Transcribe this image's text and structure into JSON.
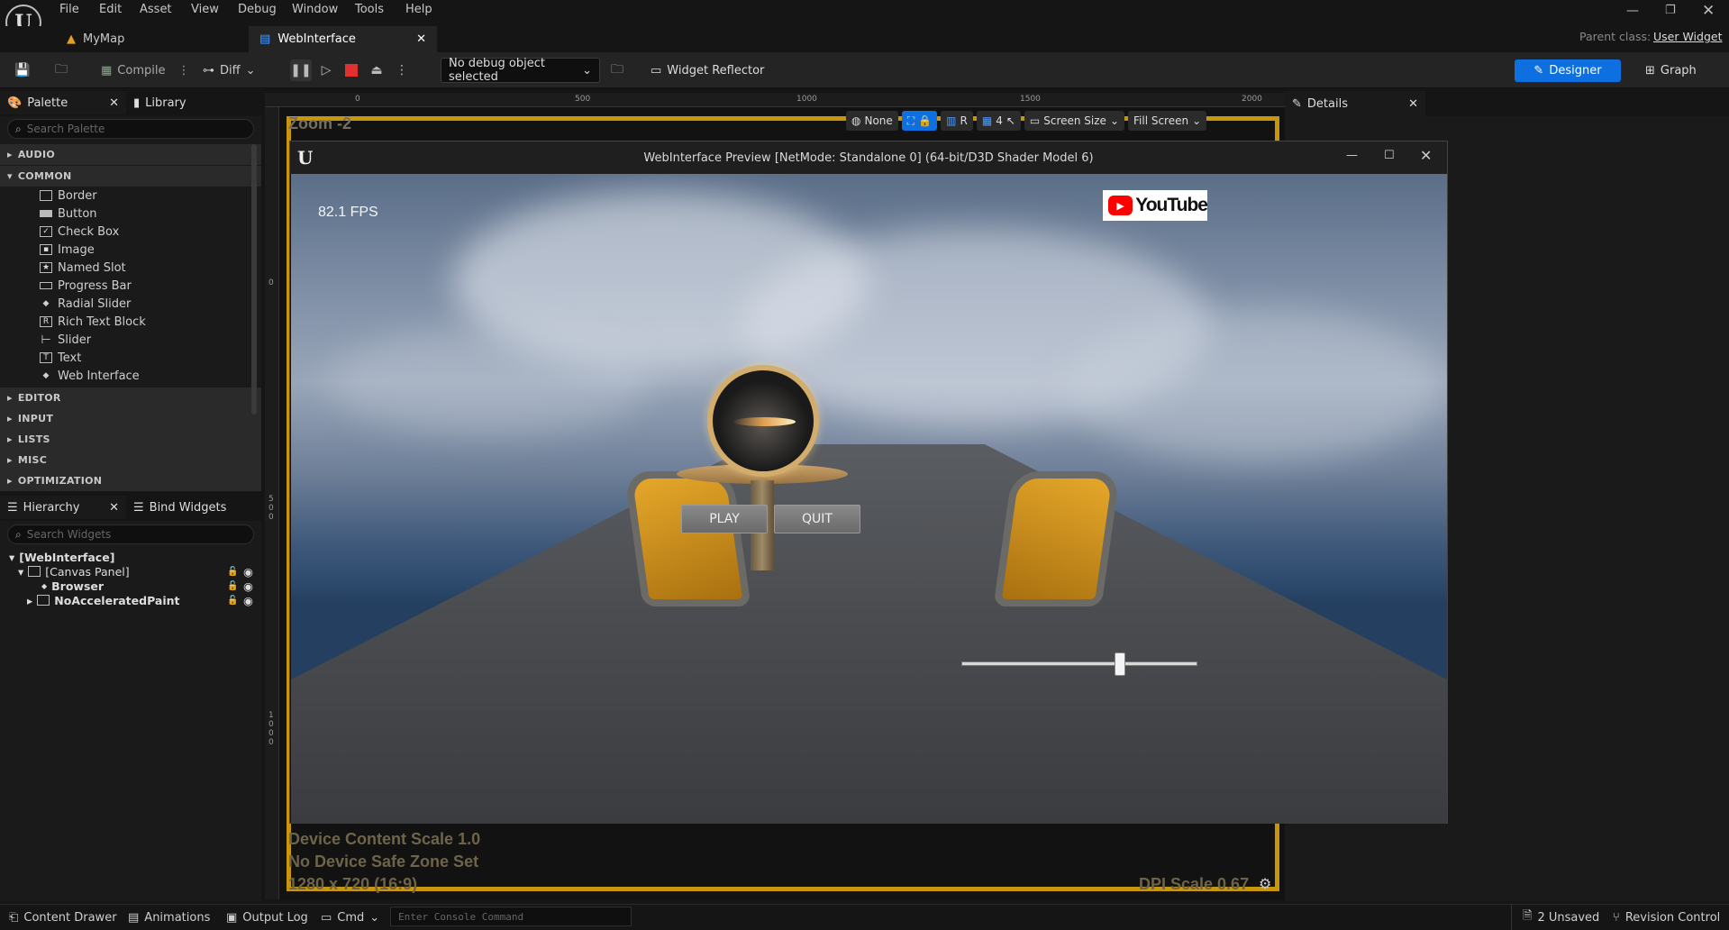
{
  "menu": [
    "File",
    "Edit",
    "Asset",
    "View",
    "Debug",
    "Window",
    "Tools",
    "Help"
  ],
  "tabs": [
    {
      "label": "MyMap"
    },
    {
      "label": "WebInterface"
    }
  ],
  "parent_class": {
    "label": "Parent class:",
    "value": "User Widget"
  },
  "toolbar": {
    "compile": "Compile",
    "diff": "Diff",
    "debug_select": "No debug object selected",
    "widget_reflector": "Widget Reflector",
    "designer": "Designer",
    "graph": "Graph"
  },
  "palette": {
    "tab": "Palette",
    "library_tab": "Library",
    "search_placeholder": "Search Palette",
    "categories": {
      "audio": "AUDIO",
      "common": "COMMON",
      "editor": "EDITOR",
      "input": "INPUT",
      "lists": "LISTS",
      "misc": "MISC",
      "optimization": "OPTIMIZATION"
    },
    "common_items": [
      "Border",
      "Button",
      "Check Box",
      "Image",
      "Named Slot",
      "Progress Bar",
      "Radial Slider",
      "Rich Text Block",
      "Slider",
      "Text",
      "Web Interface"
    ]
  },
  "hierarchy": {
    "tab": "Hierarchy",
    "bind_tab": "Bind Widgets",
    "search_placeholder": "Search Widgets",
    "root": "[WebInterface]",
    "canvas": "[Canvas Panel]",
    "browser": "Browser",
    "noaccel": "NoAcceleratedPaint"
  },
  "details": {
    "tab": "Details"
  },
  "canvas": {
    "zoom": "Zoom -2",
    "ruler_h": [
      "0",
      "500",
      "1000",
      "1500",
      "2000"
    ],
    "ruler_v": [
      "0",
      "500",
      "1000"
    ],
    "viewport_toolbar": {
      "none": "None",
      "r": "R",
      "grid_count": "4",
      "screen_size": "Screen Size",
      "fill_screen": "Fill Screen"
    },
    "device_scale": "Device Content Scale 1.0",
    "safe_zone": "No Device Safe Zone Set",
    "resolution": "1280 x 720 (16:9)",
    "dpi": "DPI Scale 0.67"
  },
  "preview": {
    "title": "WebInterface Preview [NetMode: Standalone 0]  (64-bit/D3D Shader Model 6)",
    "fps": "82.1 FPS",
    "youtube": "YouTube",
    "play": "PLAY",
    "quit": "QUIT",
    "slider_value": 0.67
  },
  "status": {
    "content_drawer": "Content Drawer",
    "animations": "Animations",
    "output_log": "Output Log",
    "cmd": "Cmd",
    "console_placeholder": "Enter Console Command",
    "unsaved": "2 Unsaved",
    "revision": "Revision Control"
  },
  "colors": {
    "accent": "#0d6fe0",
    "stop": "#e03030",
    "youtube": "#ff0000",
    "frame": "#c8960a"
  }
}
